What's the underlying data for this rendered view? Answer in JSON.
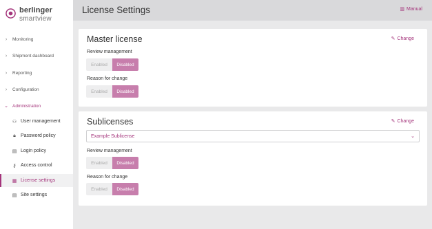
{
  "brand": {
    "name": "berlinger",
    "product": "smartview"
  },
  "sidebar": {
    "groups": [
      {
        "label": "Monitoring",
        "chevron": ">"
      },
      {
        "label": "Shipment dashboard",
        "chevron": ">"
      },
      {
        "label": "Reporting",
        "chevron": ">"
      },
      {
        "label": "Configuration",
        "chevron": ">"
      },
      {
        "label": "Administration",
        "chevron": "v"
      }
    ],
    "items": [
      {
        "label": "User management",
        "icon": "users-icon"
      },
      {
        "label": "Password policy",
        "icon": "lock-icon"
      },
      {
        "label": "Login policy",
        "icon": "clipboard-icon"
      },
      {
        "label": "Access control",
        "icon": "key-icon"
      },
      {
        "label": "License settings",
        "icon": "document-icon"
      },
      {
        "label": "Site settings",
        "icon": "page-icon"
      }
    ]
  },
  "header": {
    "title": "License Settings",
    "manual_label": "Manual"
  },
  "master": {
    "title": "Master license",
    "change_label": "Change",
    "review_label": "Review management",
    "reason_label": "Reason for change",
    "enabled_label": "Enabled",
    "disabled_label": "Disabled"
  },
  "sublicenses": {
    "title": "Sublicenses",
    "change_label": "Change",
    "selected": "Example Sublicense",
    "review_label": "Review management",
    "reason_label": "Reason for change",
    "enabled_label": "Enabled",
    "disabled_label": "Disabled"
  },
  "colors": {
    "accent": "#a4347b",
    "toggle_on": "#c77eac"
  }
}
